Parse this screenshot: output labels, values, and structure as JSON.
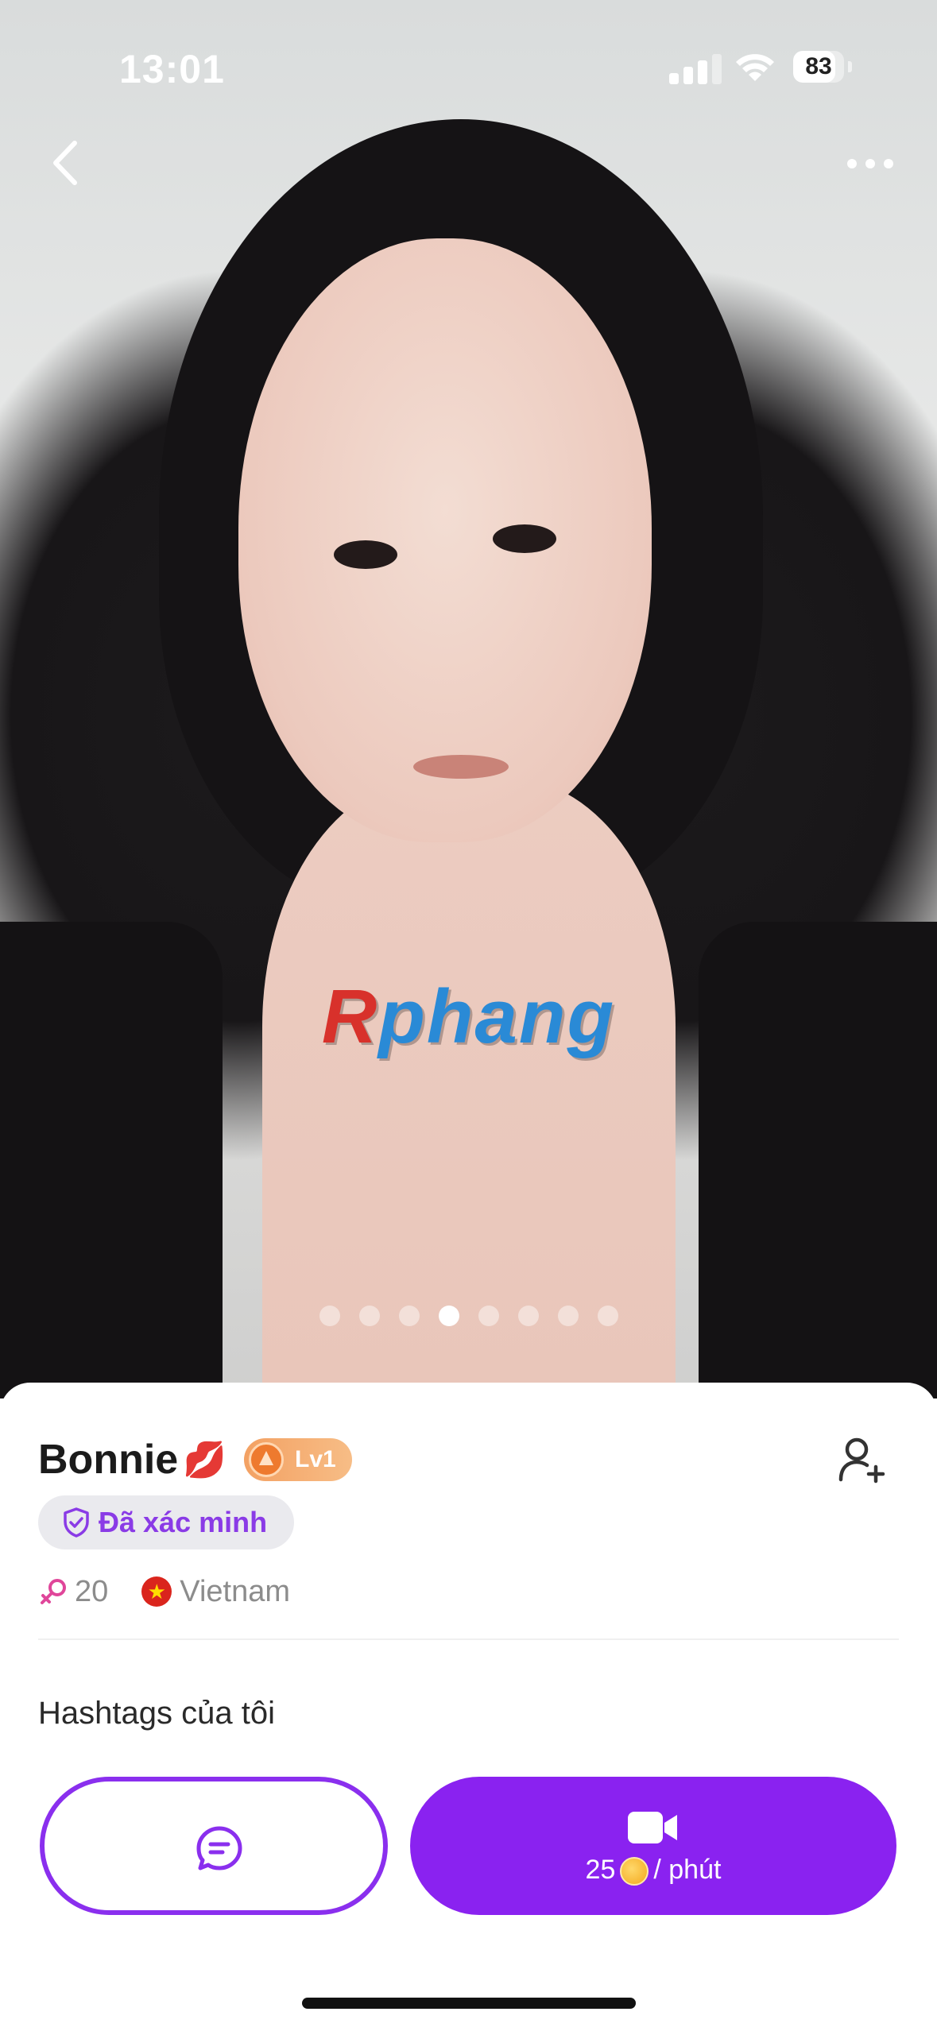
{
  "status_bar": {
    "time": "13:01",
    "battery": "83",
    "battery_level": 0.83
  },
  "photo": {
    "watermark_r": "R",
    "watermark_rest": "phang",
    "dot_count": 8,
    "active_dot_index": 3
  },
  "profile": {
    "name": "Bonnie",
    "level": "Lv1",
    "verified_label": "Đã xác minh",
    "age": "20",
    "country": "Vietnam"
  },
  "hashtags": {
    "title": "Hashtags của tôi"
  },
  "call": {
    "price": "25",
    "unit": "/ phút"
  },
  "colors": {
    "accent": "#8a22f0",
    "verified_text": "#8a3be6",
    "level_badge": "#f3a163"
  },
  "icons": {
    "back": "chevron-left-icon",
    "more": "more-horizontal-icon",
    "add_friend": "add-user-icon",
    "verified": "shield-check-icon",
    "gender": "female-icon",
    "flag": "vietnam-flag-icon",
    "chat": "chat-bubble-icon",
    "video": "video-camera-icon",
    "coin": "coin-icon"
  }
}
